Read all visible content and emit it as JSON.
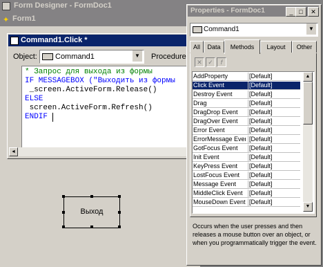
{
  "form_designer": {
    "title": "Form Designer - FormDoc1"
  },
  "form1": {
    "title": "Form1",
    "button_caption": "Выход"
  },
  "code_window": {
    "title": "Command1.Click *",
    "object_label": "Object:",
    "object_value": "Command1",
    "procedure_label": "Procedure",
    "lines": [
      "* Запрос для выхода из формы",
      "IF MESSAGEBOX (\"Выходить из формы",
      " _screen.ActiveForm.Release()",
      "ELSE",
      " screen.ActiveForm.Refresh()",
      "ENDIF"
    ]
  },
  "properties": {
    "title": "Properties - FormDoc1",
    "object_select": "Command1",
    "tabs": [
      "All",
      "Data",
      "Methods",
      "Layout",
      "Other"
    ],
    "active_tab": "Methods",
    "rows": [
      {
        "name": "AddProperty",
        "value": "[Default]"
      },
      {
        "name": "Click Event",
        "value": "[Default]"
      },
      {
        "name": "Destroy Event",
        "value": "[Default]"
      },
      {
        "name": "Drag",
        "value": "[Default]"
      },
      {
        "name": "DragDrop Event",
        "value": "[Default]"
      },
      {
        "name": "DragOver Event",
        "value": "[Default]"
      },
      {
        "name": "Error Event",
        "value": "[Default]"
      },
      {
        "name": "ErrorMessage Event",
        "value": "[Default]"
      },
      {
        "name": "GotFocus Event",
        "value": "[Default]"
      },
      {
        "name": "Init Event",
        "value": "[Default]"
      },
      {
        "name": "KeyPress Event",
        "value": "[Default]"
      },
      {
        "name": "LostFocus Event",
        "value": "[Default]"
      },
      {
        "name": "Message Event",
        "value": "[Default]"
      },
      {
        "name": "MiddleClick Event",
        "value": "[Default]"
      },
      {
        "name": "MouseDown Event",
        "value": "[Default]"
      }
    ],
    "selected_row": "Click Event",
    "description": "Occurs when the user presses and then releases a mouse button over an object, or when you programmatically trigger the event."
  },
  "colors": {
    "active_title": "#0a246a",
    "inactive_title": "#848284",
    "face": "#d4d0c8",
    "workspace": "#808080",
    "code_comment": "#008000",
    "code_keyword": "#0000ff"
  }
}
